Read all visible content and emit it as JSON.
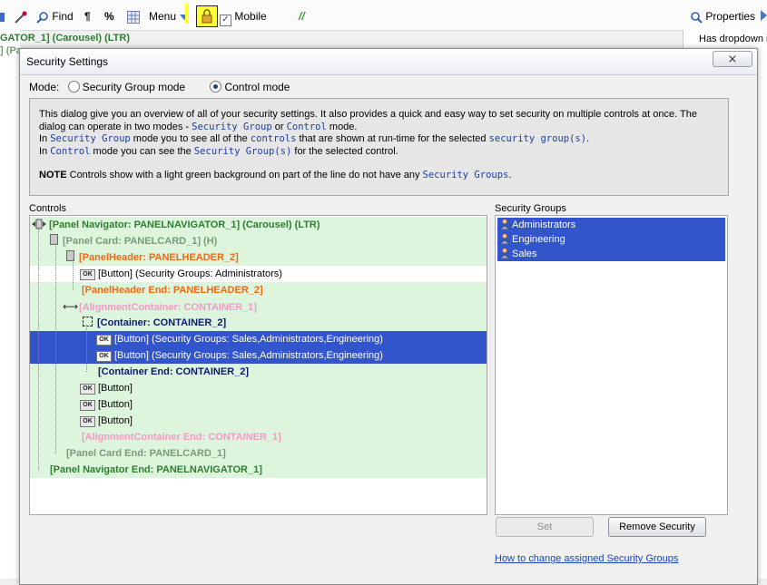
{
  "toolbar": {
    "find_label": "Find",
    "pilcrow_label": "¶",
    "percent_label": "%",
    "menu_label": "Menu",
    "mobile_label": "Mobile",
    "slash_label": "//",
    "properties_label": "Properties"
  },
  "background": {
    "tree_row_1": "GATOR_1] (Carousel) (LTR)",
    "tree_row_2": "] (Pa",
    "right_panel_text": "Has dropdown in"
  },
  "dialog": {
    "title": "Security Settings",
    "close_glyph": "⨯",
    "mode_label": "Mode:",
    "mode_options": [
      {
        "label": "Security Group mode",
        "selected": false
      },
      {
        "label": "Control mode",
        "selected": true
      }
    ],
    "info": {
      "line1": "This dialog give you an overview of all of your security settings. It also provides a quick and easy way to set security on multiple controls at once. The",
      "line2_a": "dialog can operate in two modes - ",
      "line2_code1": "Security Group",
      "line2_b": " or ",
      "line2_code2": "Control",
      "line2_c": " mode.",
      "line3_a": "In ",
      "line3_code1": "Security Group",
      "line3_b": " mode you to see all of the ",
      "line3_code2": "controls",
      "line3_c": " that are shown at run-time for the selected ",
      "line3_code3": "security group(s)",
      "line3_d": ".",
      "line4_a": "In ",
      "line4_code1": "Control",
      "line4_b": " mode you can see the ",
      "line4_code2": "Security Group(s)",
      "line4_c": " for the selected control.",
      "note_label": "NOTE",
      "note_text": "  Controls show with a light green background on part of the line do not have any ",
      "note_code": "Security Groups",
      "note_end": "."
    },
    "controls_label": "Controls",
    "groups_label": "Security Groups",
    "tree": [
      {
        "text": "[Panel Navigator: PANELNAVIGATOR_1] (Carousel) (LTR)"
      },
      {
        "text": "[Panel Card: PANELCARD_1]  (H)"
      },
      {
        "text": "[PanelHeader: PANELHEADER_2]"
      },
      {
        "text": "[Button]  (Security Groups: Administrators)"
      },
      {
        "text": "[PanelHeader End: PANELHEADER_2]"
      },
      {
        "text": "[AlignmentContainer: CONTAINER_1]"
      },
      {
        "text": "[Container: CONTAINER_2]"
      },
      {
        "text": "[Button]  (Security Groups: Sales,Administrators,Engineering)"
      },
      {
        "text": "[Button]  (Security Groups: Sales,Administrators,Engineering)"
      },
      {
        "text": "[Container End: CONTAINER_2]"
      },
      {
        "text": "[Button]"
      },
      {
        "text": "[Button]"
      },
      {
        "text": "[Button]"
      },
      {
        "text": "[AlignmentContainer End: CONTAINER_1]"
      },
      {
        "text": "[Panel Card End: PANELCARD_1]"
      },
      {
        "text": "[Panel Navigator End: PANELNAVIGATOR_1]"
      }
    ],
    "ok_badge": "OK",
    "groups": [
      "Administrators",
      "Engineering",
      "Sales"
    ],
    "set_label": "Set",
    "remove_label": "Remove Security",
    "help_link": "How to change assigned Security Groups"
  },
  "colors": {
    "selection": "#3355cc",
    "no_security_bg": "#dcf5dc",
    "link": "#1b44b8"
  }
}
